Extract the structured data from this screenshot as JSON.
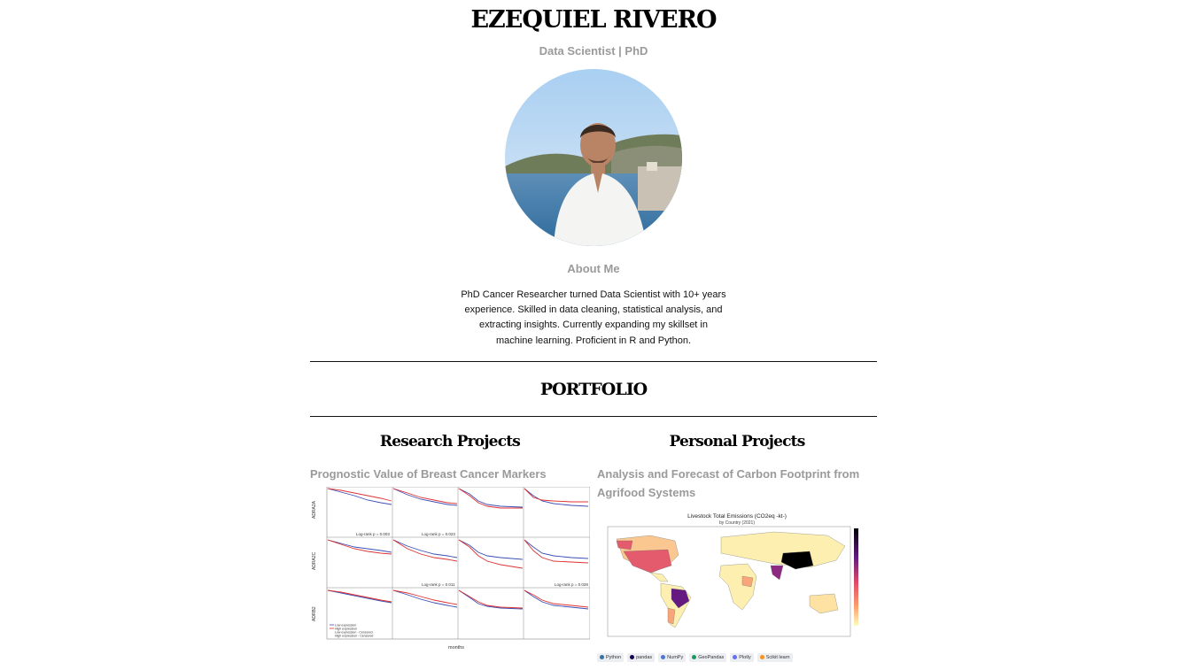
{
  "header": {
    "name": "EZEQUIEL RIVERO",
    "subtitle": "Data Scientist | PhD"
  },
  "about": {
    "heading": "About Me",
    "text": "PhD Cancer Researcher turned Data Scientist with 10+ years experience. Skilled in data cleaning, statistical analysis, and extracting insights. Currently expanding my skillset in machine learning. Proficient in R and Python."
  },
  "portfolio": {
    "heading": "PORTFOLIO",
    "research": {
      "heading": "Research Projects",
      "project_title": "Prognostic Value of Breast Cancer Markers",
      "figure": {
        "row_labels": [
          "ADRA2A",
          "ADRA2C",
          "ADRB2"
        ],
        "pvalues": [
          "Log-rank p = 0.003",
          "Log-rank p = 0.023",
          "Log-rank p = 0.011",
          "Log-rank p = 0.028"
        ],
        "xlabel": "months",
        "legend": [
          "Low expression",
          "High expression",
          "Low expression - Censored",
          "High expression - Censored"
        ]
      }
    },
    "personal": {
      "heading": "Personal Projects",
      "project_title": "Analysis and Forecast of Carbon Footprint from Agrifood Systems",
      "figure": {
        "title": "Livestock Total Emissions (CO2eq -kt-)",
        "subtitle": "by Country (2021)"
      },
      "tags": [
        {
          "label": "Python",
          "color": "#3572A5"
        },
        {
          "label": "pandas",
          "color": "#150458"
        },
        {
          "label": "NumPy",
          "color": "#4d77cf"
        },
        {
          "label": "GeoPandas",
          "color": "#139C5A"
        },
        {
          "label": "Plotly",
          "color": "#636efa"
        },
        {
          "label": "Scikit learn",
          "color": "#f7931e"
        }
      ]
    }
  }
}
